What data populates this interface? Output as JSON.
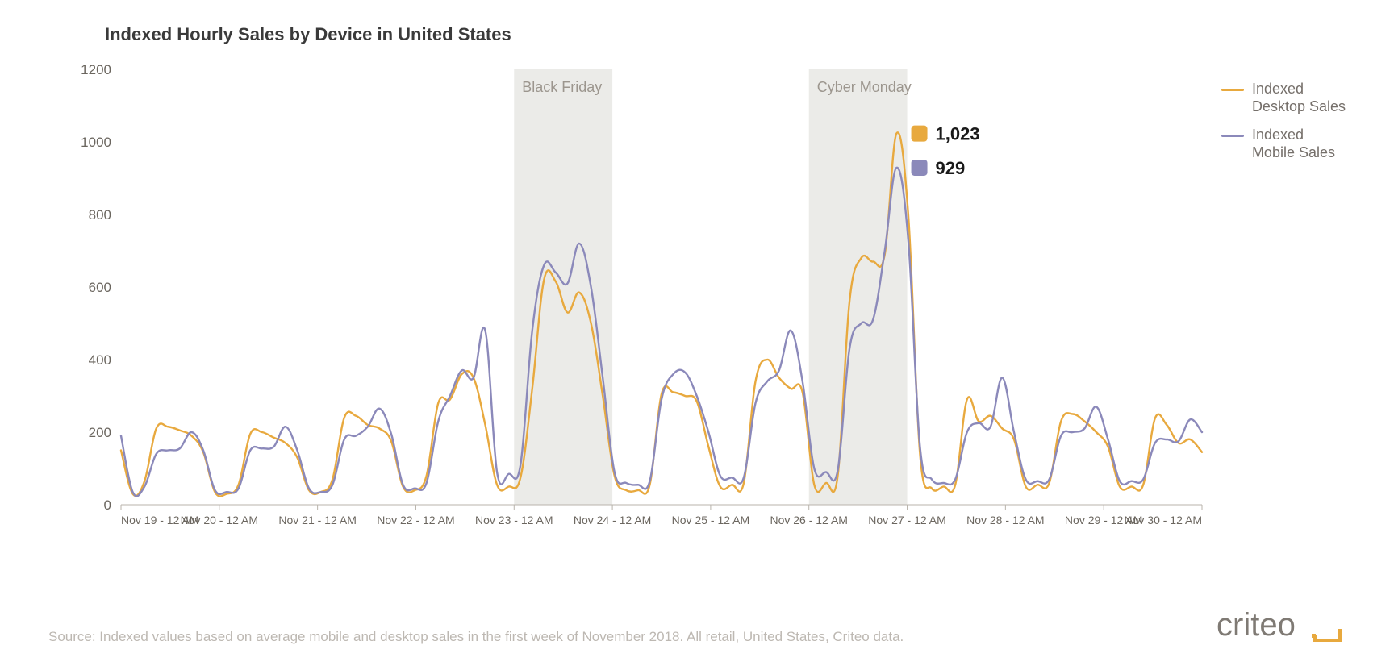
{
  "chart_data": {
    "type": "line",
    "title": "Indexed Hourly Sales by Device in United States",
    "xlabel": "",
    "ylabel": "",
    "ylim": [
      0,
      1200
    ],
    "y_ticks": [
      0,
      200,
      400,
      600,
      800,
      1000,
      1200
    ],
    "x_categories": [
      "Nov 19 - 12 AM",
      "Nov 20 - 12 AM",
      "Nov 21 - 12 AM",
      "Nov 22 - 12 AM",
      "Nov 23 - 12 AM",
      "Nov 24 - 12 AM",
      "Nov 25 - 12 AM",
      "Nov 26 - 12 AM",
      "Nov 27 - 12 AM",
      "Nov 28 - 12 AM",
      "Nov 29 - 12 AM",
      "Nov 30 - 12 AM"
    ],
    "annotations": [
      {
        "label": "Black Friday",
        "x_start": 4,
        "x_end": 5
      },
      {
        "label": "Cyber Monday",
        "x_start": 7,
        "x_end": 8
      }
    ],
    "series": [
      {
        "name": "Indexed Desktop Sales",
        "color": "#e8a93e",
        "data_label_value": "1,023",
        "values": [
          150,
          30,
          65,
          210,
          215,
          205,
          190,
          145,
          35,
          30,
          55,
          195,
          200,
          185,
          170,
          130,
          40,
          35,
          70,
          240,
          245,
          220,
          210,
          175,
          50,
          40,
          80,
          280,
          290,
          360,
          350,
          220,
          55,
          50,
          75,
          320,
          620,
          615,
          530,
          585,
          500,
          300,
          80,
          40,
          40,
          55,
          305,
          310,
          300,
          285,
          160,
          50,
          55,
          60,
          340,
          400,
          350,
          320,
          310,
          55,
          60,
          80,
          560,
          680,
          670,
          690,
          1023,
          800,
          140,
          45,
          50,
          55,
          290,
          230,
          245,
          210,
          180,
          50,
          55,
          60,
          230,
          250,
          230,
          200,
          160,
          50,
          50,
          55,
          238,
          220,
          170,
          180,
          145
        ]
      },
      {
        "name": "Indexed Mobile Sales",
        "color": "#8b89ba",
        "data_label_value": "929",
        "values": [
          190,
          35,
          50,
          140,
          150,
          155,
          200,
          150,
          40,
          35,
          45,
          150,
          155,
          160,
          215,
          150,
          45,
          35,
          55,
          180,
          190,
          215,
          265,
          195,
          55,
          45,
          60,
          230,
          300,
          370,
          350,
          480,
          90,
          85,
          110,
          480,
          660,
          640,
          610,
          720,
          600,
          350,
          90,
          60,
          55,
          65,
          290,
          360,
          365,
          300,
          200,
          80,
          75,
          75,
          280,
          340,
          370,
          480,
          340,
          100,
          90,
          95,
          430,
          500,
          510,
          700,
          929,
          730,
          160,
          70,
          60,
          70,
          200,
          225,
          215,
          350,
          200,
          70,
          65,
          70,
          190,
          200,
          210,
          270,
          180,
          65,
          65,
          70,
          170,
          180,
          175,
          235,
          200
        ]
      }
    ]
  },
  "legend": [
    {
      "label": "Indexed\nDesktop Sales",
      "color": "#e8a93e"
    },
    {
      "label": "Indexed\nMobile Sales",
      "color": "#8b89ba"
    }
  ],
  "source_text": "Source: Indexed values based on average mobile and desktop sales in the first week of November 2018. All retail, United States, Criteo data.",
  "logo_text": "criteo",
  "data_labels": [
    {
      "value": "1,023",
      "color": "#e8a93e",
      "y": 1023,
      "x_frac": 0.7325
    },
    {
      "value": "929",
      "color": "#8b89ba",
      "y": 929,
      "x_frac": 0.7325
    }
  ]
}
